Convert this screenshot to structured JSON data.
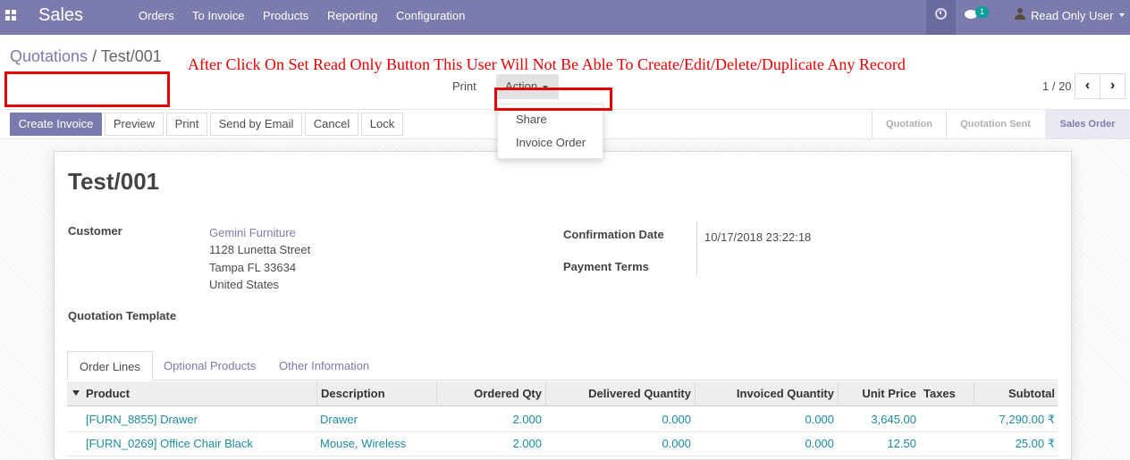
{
  "navbar": {
    "app_name": "Sales",
    "menu": [
      "Orders",
      "To Invoice",
      "Products",
      "Reporting",
      "Configuration"
    ],
    "chat_count": "1",
    "user_name": "Read Only User",
    "color": "#7c7bad"
  },
  "breadcrumb": {
    "parent": "Quotations",
    "separator": " / ",
    "current": "Test/001"
  },
  "annotation": "After Click On Set Read Only Button This User Will Not Be Able To Create/Edit/Delete/Duplicate Any Record",
  "sidebar": {
    "print_label": "Print",
    "action_label": "Action",
    "action_items": [
      "Share",
      "Invoice Order"
    ]
  },
  "pager": {
    "value": "1 / 20",
    "prev": "‹",
    "next": "›"
  },
  "statusbar": {
    "buttons": [
      "Create Invoice",
      "Preview",
      "Print",
      "Send by Email",
      "Cancel",
      "Lock"
    ],
    "stages": [
      "Quotation",
      "Quotation Sent",
      "Sales Order"
    ],
    "active_stage": "Sales Order"
  },
  "form": {
    "name": "Test/001",
    "customer_label": "Customer",
    "customer_name": "Gemini Furniture",
    "address": [
      "1128 Lunetta Street",
      "Tampa FL 33634",
      "United States"
    ],
    "quotation_template_label": "Quotation Template",
    "confirmation_date_label": "Confirmation Date",
    "confirmation_date": "10/17/2018 23:22:18",
    "payment_terms_label": "Payment Terms"
  },
  "tabs": [
    "Order Lines",
    "Optional Products",
    "Other Information"
  ],
  "order_lines": {
    "columns": [
      "Product",
      "Description",
      "Ordered Qty",
      "Delivered Quantity",
      "Invoiced Quantity",
      "Unit Price",
      "Taxes",
      "Subtotal"
    ],
    "rows": [
      {
        "product": "[FURN_8855] Drawer",
        "description": "Drawer",
        "ordered_qty": "2.000",
        "delivered_qty": "0.000",
        "invoiced_qty": "0.000",
        "unit_price": "3,645.00",
        "taxes": "",
        "subtotal": "7,290.00 ₹"
      },
      {
        "product": "[FURN_0269] Office Chair Black",
        "description": "Mouse, Wireless",
        "ordered_qty": "2.000",
        "delivered_qty": "0.000",
        "invoiced_qty": "0.000",
        "unit_price": "12.50",
        "taxes": "",
        "subtotal": "25.00 ₹"
      }
    ]
  }
}
